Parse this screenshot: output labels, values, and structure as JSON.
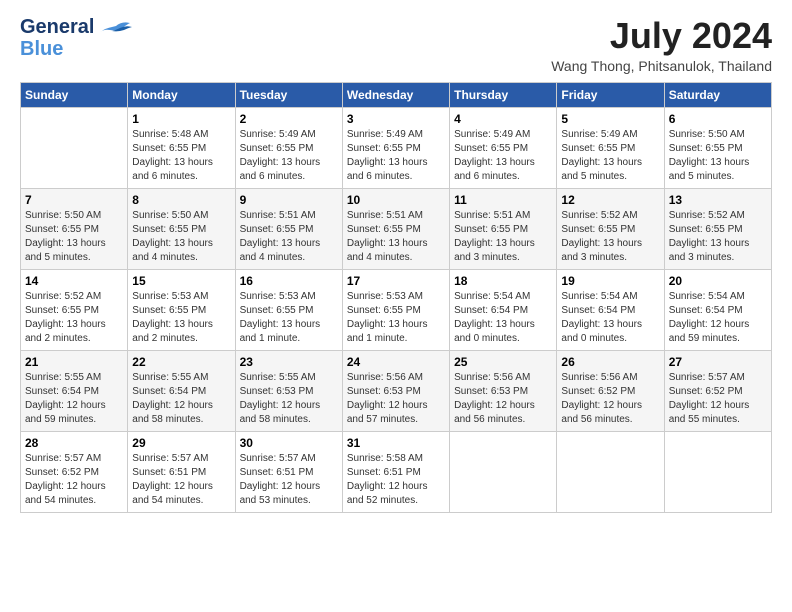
{
  "header": {
    "logo_line1": "General",
    "logo_line2": "Blue",
    "month": "July 2024",
    "location": "Wang Thong, Phitsanulok, Thailand"
  },
  "columns": [
    "Sunday",
    "Monday",
    "Tuesday",
    "Wednesday",
    "Thursday",
    "Friday",
    "Saturday"
  ],
  "weeks": [
    [
      {
        "day": "",
        "info": ""
      },
      {
        "day": "1",
        "info": "Sunrise: 5:48 AM\nSunset: 6:55 PM\nDaylight: 13 hours\nand 6 minutes."
      },
      {
        "day": "2",
        "info": "Sunrise: 5:49 AM\nSunset: 6:55 PM\nDaylight: 13 hours\nand 6 minutes."
      },
      {
        "day": "3",
        "info": "Sunrise: 5:49 AM\nSunset: 6:55 PM\nDaylight: 13 hours\nand 6 minutes."
      },
      {
        "day": "4",
        "info": "Sunrise: 5:49 AM\nSunset: 6:55 PM\nDaylight: 13 hours\nand 6 minutes."
      },
      {
        "day": "5",
        "info": "Sunrise: 5:49 AM\nSunset: 6:55 PM\nDaylight: 13 hours\nand 5 minutes."
      },
      {
        "day": "6",
        "info": "Sunrise: 5:50 AM\nSunset: 6:55 PM\nDaylight: 13 hours\nand 5 minutes."
      }
    ],
    [
      {
        "day": "7",
        "info": "Sunrise: 5:50 AM\nSunset: 6:55 PM\nDaylight: 13 hours\nand 5 minutes."
      },
      {
        "day": "8",
        "info": "Sunrise: 5:50 AM\nSunset: 6:55 PM\nDaylight: 13 hours\nand 4 minutes."
      },
      {
        "day": "9",
        "info": "Sunrise: 5:51 AM\nSunset: 6:55 PM\nDaylight: 13 hours\nand 4 minutes."
      },
      {
        "day": "10",
        "info": "Sunrise: 5:51 AM\nSunset: 6:55 PM\nDaylight: 13 hours\nand 4 minutes."
      },
      {
        "day": "11",
        "info": "Sunrise: 5:51 AM\nSunset: 6:55 PM\nDaylight: 13 hours\nand 3 minutes."
      },
      {
        "day": "12",
        "info": "Sunrise: 5:52 AM\nSunset: 6:55 PM\nDaylight: 13 hours\nand 3 minutes."
      },
      {
        "day": "13",
        "info": "Sunrise: 5:52 AM\nSunset: 6:55 PM\nDaylight: 13 hours\nand 3 minutes."
      }
    ],
    [
      {
        "day": "14",
        "info": "Sunrise: 5:52 AM\nSunset: 6:55 PM\nDaylight: 13 hours\nand 2 minutes."
      },
      {
        "day": "15",
        "info": "Sunrise: 5:53 AM\nSunset: 6:55 PM\nDaylight: 13 hours\nand 2 minutes."
      },
      {
        "day": "16",
        "info": "Sunrise: 5:53 AM\nSunset: 6:55 PM\nDaylight: 13 hours\nand 1 minute."
      },
      {
        "day": "17",
        "info": "Sunrise: 5:53 AM\nSunset: 6:55 PM\nDaylight: 13 hours\nand 1 minute."
      },
      {
        "day": "18",
        "info": "Sunrise: 5:54 AM\nSunset: 6:54 PM\nDaylight: 13 hours\nand 0 minutes."
      },
      {
        "day": "19",
        "info": "Sunrise: 5:54 AM\nSunset: 6:54 PM\nDaylight: 13 hours\nand 0 minutes."
      },
      {
        "day": "20",
        "info": "Sunrise: 5:54 AM\nSunset: 6:54 PM\nDaylight: 12 hours\nand 59 minutes."
      }
    ],
    [
      {
        "day": "21",
        "info": "Sunrise: 5:55 AM\nSunset: 6:54 PM\nDaylight: 12 hours\nand 59 minutes."
      },
      {
        "day": "22",
        "info": "Sunrise: 5:55 AM\nSunset: 6:54 PM\nDaylight: 12 hours\nand 58 minutes."
      },
      {
        "day": "23",
        "info": "Sunrise: 5:55 AM\nSunset: 6:53 PM\nDaylight: 12 hours\nand 58 minutes."
      },
      {
        "day": "24",
        "info": "Sunrise: 5:56 AM\nSunset: 6:53 PM\nDaylight: 12 hours\nand 57 minutes."
      },
      {
        "day": "25",
        "info": "Sunrise: 5:56 AM\nSunset: 6:53 PM\nDaylight: 12 hours\nand 56 minutes."
      },
      {
        "day": "26",
        "info": "Sunrise: 5:56 AM\nSunset: 6:52 PM\nDaylight: 12 hours\nand 56 minutes."
      },
      {
        "day": "27",
        "info": "Sunrise: 5:57 AM\nSunset: 6:52 PM\nDaylight: 12 hours\nand 55 minutes."
      }
    ],
    [
      {
        "day": "28",
        "info": "Sunrise: 5:57 AM\nSunset: 6:52 PM\nDaylight: 12 hours\nand 54 minutes."
      },
      {
        "day": "29",
        "info": "Sunrise: 5:57 AM\nSunset: 6:51 PM\nDaylight: 12 hours\nand 54 minutes."
      },
      {
        "day": "30",
        "info": "Sunrise: 5:57 AM\nSunset: 6:51 PM\nDaylight: 12 hours\nand 53 minutes."
      },
      {
        "day": "31",
        "info": "Sunrise: 5:58 AM\nSunset: 6:51 PM\nDaylight: 12 hours\nand 52 minutes."
      },
      {
        "day": "",
        "info": ""
      },
      {
        "day": "",
        "info": ""
      },
      {
        "day": "",
        "info": ""
      }
    ]
  ]
}
